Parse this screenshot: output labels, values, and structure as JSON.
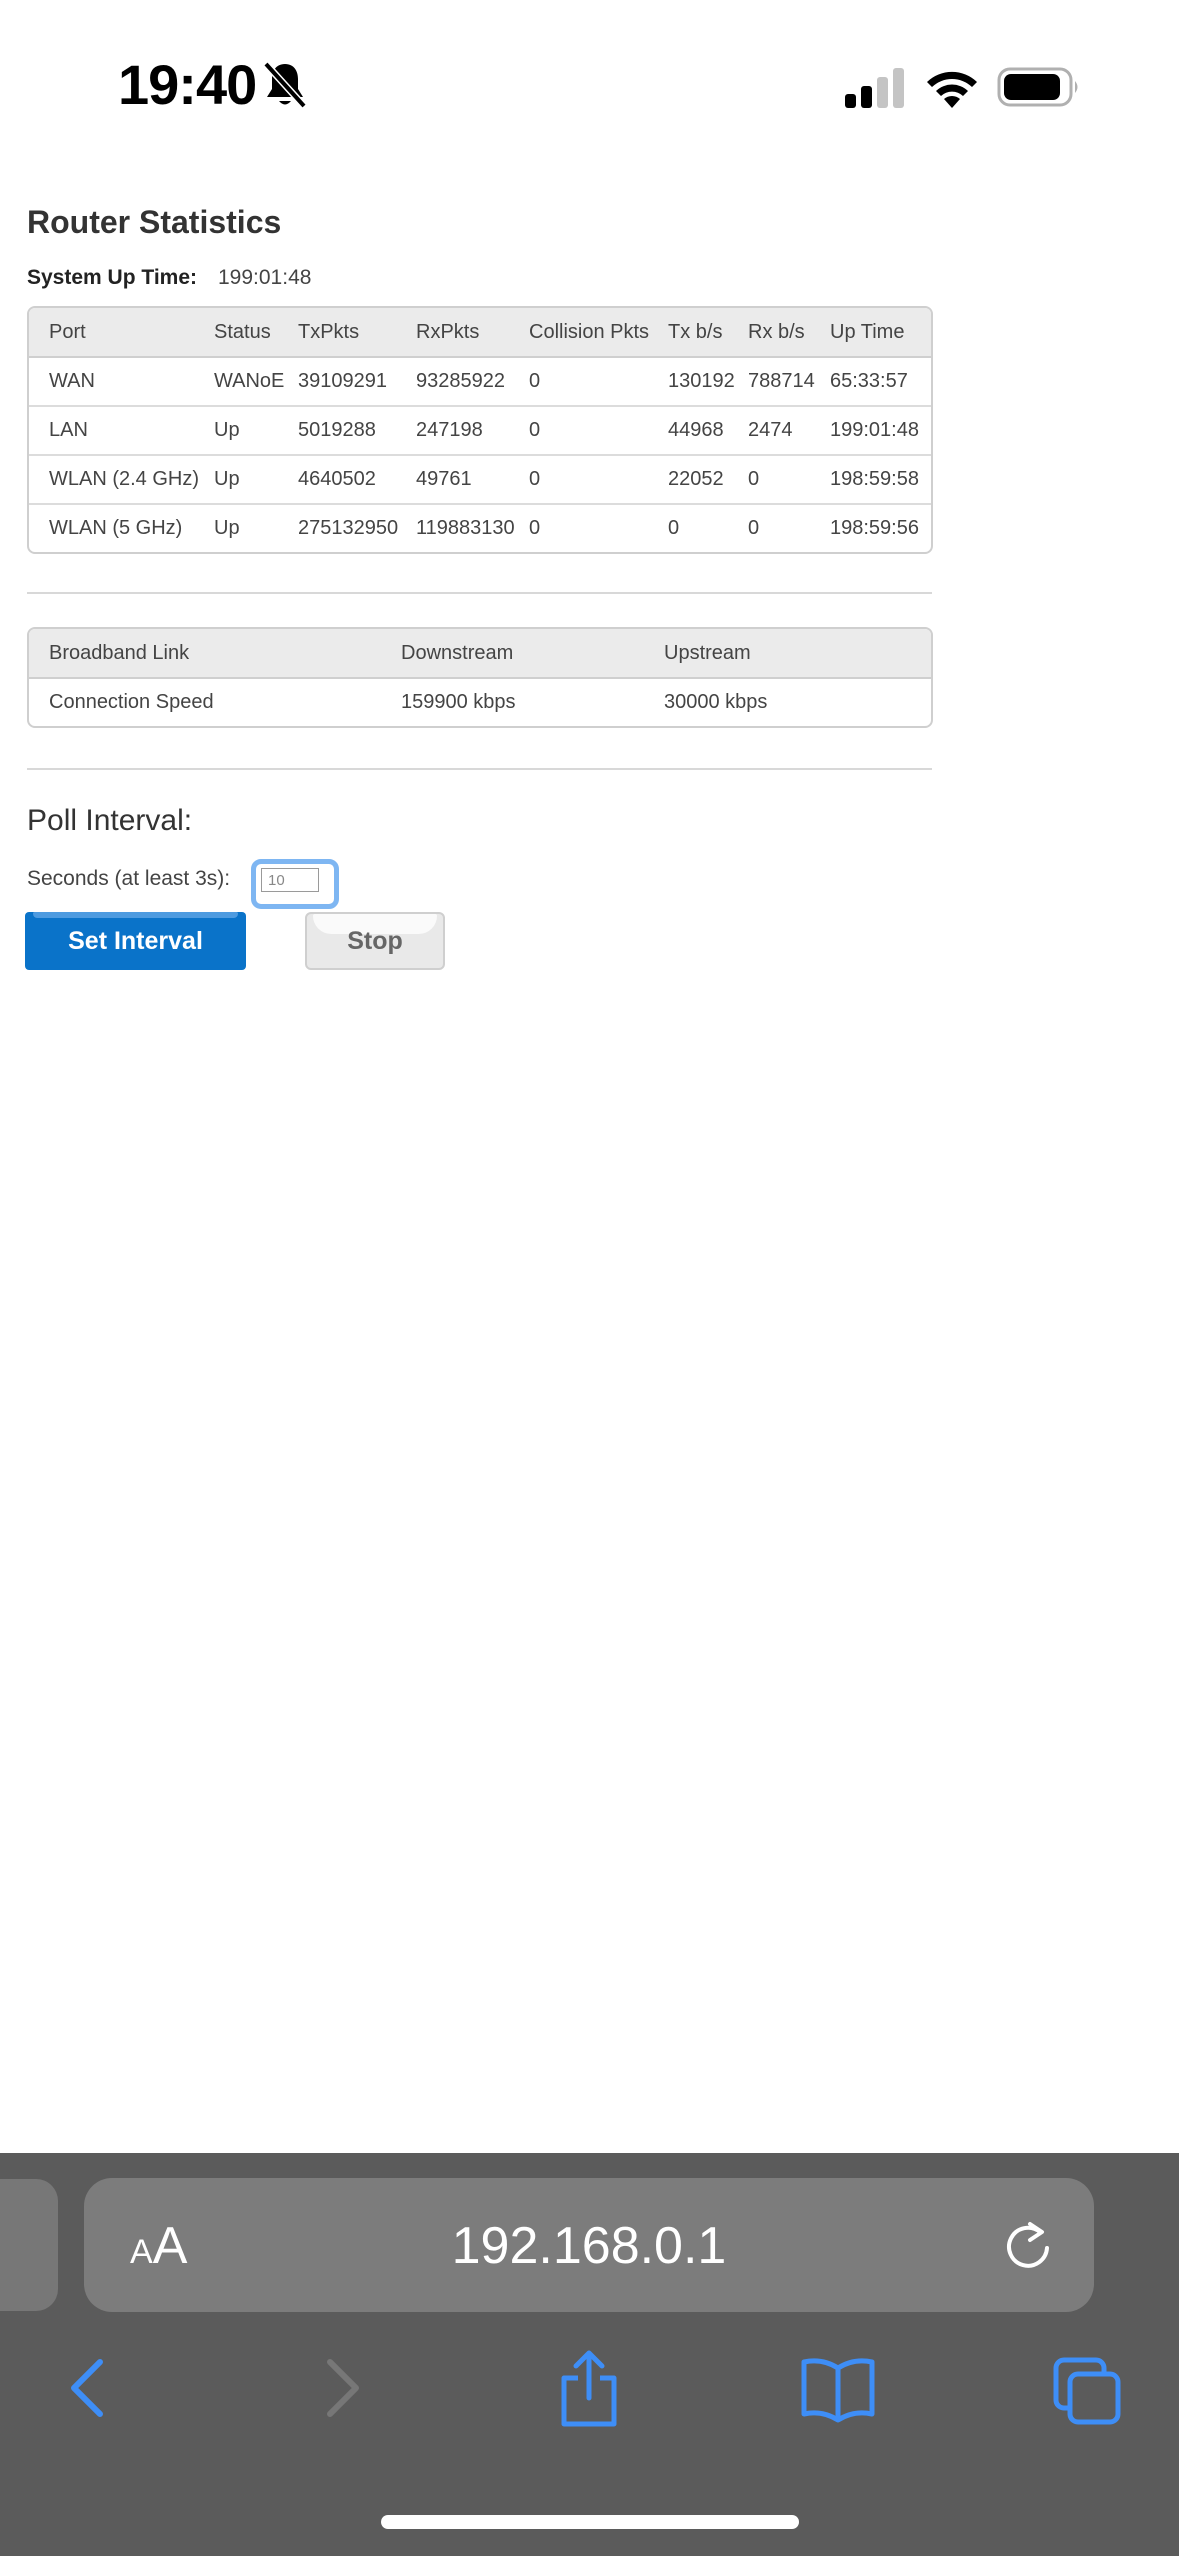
{
  "status_bar": {
    "time": "19:40"
  },
  "page": {
    "title": "Router Statistics",
    "uptime_label": "System Up Time:",
    "uptime_value": "199:01:48"
  },
  "stats_table": {
    "headers": [
      "Port",
      "Status",
      "TxPkts",
      "RxPkts",
      "Collision Pkts",
      "Tx b/s",
      "Rx b/s",
      "Up Time"
    ],
    "rows": [
      [
        "WAN",
        "WANoE",
        "39109291",
        "93285922",
        "0",
        "130192",
        "788714",
        "65:33:57"
      ],
      [
        "LAN",
        "Up",
        "5019288",
        "247198",
        "0",
        "44968",
        "2474",
        "199:01:48"
      ],
      [
        "WLAN (2.4 GHz)",
        "Up",
        "4640502",
        "49761",
        "0",
        "22052",
        "0",
        "198:59:58"
      ],
      [
        "WLAN (5 GHz)",
        "Up",
        "275132950",
        "119883130",
        "0",
        "0",
        "0",
        "198:59:56"
      ]
    ]
  },
  "broadband_table": {
    "headers": [
      "Broadband Link",
      "Downstream",
      "Upstream"
    ],
    "rows": [
      [
        "Connection Speed",
        "159900 kbps",
        "30000 kbps"
      ]
    ]
  },
  "poll": {
    "title": "Poll Interval:",
    "label": "Seconds (at least 3s):",
    "input_value": "10",
    "set_button": "Set Interval",
    "stop_button": "Stop"
  },
  "browser": {
    "aa_small": "A",
    "aa_big": "A",
    "url": "192.168.0.1"
  },
  "colors": {
    "accent": "#0a73c9",
    "toolbar_bg": "#5b5b5b",
    "icon_blue": "#3e8ef7"
  }
}
